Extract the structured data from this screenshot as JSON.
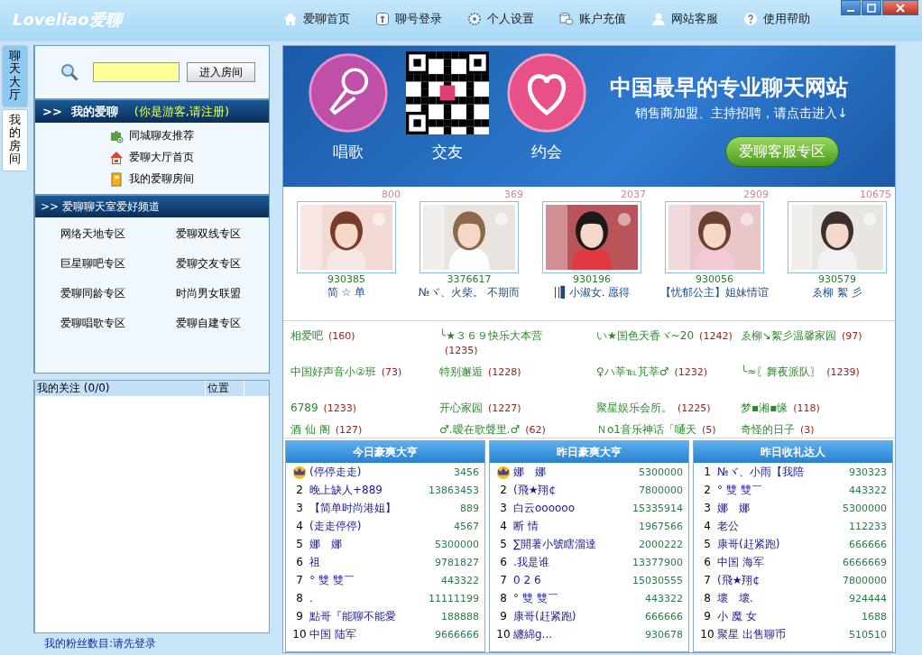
{
  "app": {
    "logo": "Loveliao爱聊"
  },
  "nav": [
    {
      "label": "爱聊首页"
    },
    {
      "label": "聊号登录"
    },
    {
      "label": "个人设置"
    },
    {
      "label": "账户充值"
    },
    {
      "label": "网站客服"
    },
    {
      "label": "使用帮助"
    }
  ],
  "side_tabs": [
    {
      "label": "聊天大厅",
      "selected": true
    },
    {
      "label": "我的房间",
      "selected": false
    }
  ],
  "search": {
    "button": "进入房间"
  },
  "my_section": {
    "title": "我的爱聊",
    "note": "(你是游客,请注册)",
    "arrow": ">>",
    "links": [
      {
        "label": "同城聊友推荐"
      },
      {
        "label": "爱聊大厅首页"
      },
      {
        "label": "我的爱聊房间"
      }
    ]
  },
  "channel_section": {
    "arrow": ">>",
    "title": "爱聊聊天室爱好频道",
    "zones": [
      "网络天地专区",
      "爱聊双线专区",
      "巨星聊吧专区",
      "爱聊交友专区",
      "爱聊同龄专区",
      "时尚男女联盟",
      "爱聊唱歌专区",
      "爱聊自建专区"
    ]
  },
  "follow_list": {
    "columns": [
      "我的关注 (0/0)",
      "位置"
    ]
  },
  "fans": "我的粉丝数目:请先登录",
  "banner": {
    "features": [
      {
        "label": "唱歌"
      },
      {
        "label": "交友"
      },
      {
        "label": "约会"
      }
    ],
    "headline": "中国最早的专业聊天网站",
    "subline": "销售商加盟、主持招聘，请点击进入↓",
    "button": "爱聊客服专区"
  },
  "hosts": [
    {
      "count": "800",
      "id": "930385",
      "name": "简 ☆ 单"
    },
    {
      "count": "369",
      "id": "3376617",
      "name": "№ヾ、火柴。 不期而"
    },
    {
      "count": "2037",
      "id": "930196",
      "name": "||▌小淑女. 愿得"
    },
    {
      "count": "2909",
      "id": "930056",
      "name": "【忧郁公主】姐妹情谊"
    },
    {
      "count": "10675",
      "id": "930579",
      "name": "ゑ柳 絮 彡"
    }
  ],
  "rooms": [
    {
      "name": "相爱吧",
      "count": "(160)"
    },
    {
      "name": "╰★３６９快乐大本营",
      "count": "(1235)"
    },
    {
      "name": "い★国色天香ヾ~20",
      "count": "(1242)"
    },
    {
      "name": "ゑ柳↘絮彡温馨家园",
      "count": "(97)"
    },
    {
      "name": "中国好声音小②班",
      "count": "(73)"
    },
    {
      "name": "特别邂逅",
      "count": "(1228)"
    },
    {
      "name": "♀ハ莘℡芃莘♂",
      "count": "(1232)"
    },
    {
      "name": "╰≈〖舞夜派队〗",
      "count": "(1239)"
    },
    {
      "name": "6789",
      "count": "(1233)"
    },
    {
      "name": "开心家园",
      "count": "(1227)"
    },
    {
      "name": "聚星娱乐会所。",
      "count": "(1225)"
    },
    {
      "name": "梦▪湘▪缘",
      "count": "(118)"
    },
    {
      "name": "酒 仙 阁",
      "count": "(127)"
    },
    {
      "name": "♂.暧在歌聲里.♂",
      "count": "(62)"
    },
    {
      "name": "Ｎo1音乐神话「嗵天",
      "count": "(5)"
    },
    {
      "name": "奇怪的日子",
      "count": "(3)"
    }
  ],
  "rankings": [
    {
      "title": "今日豪爽大亨",
      "rows": [
        {
          "kind": "crown",
          "name": "(停停走走)",
          "value": "3456"
        },
        {
          "kind": "number",
          "rank": "2",
          "name": "晚上缺人+889",
          "value": "13863453"
        },
        {
          "kind": "number",
          "rank": "3",
          "name": "【简单时尚港姐】",
          "value": "889"
        },
        {
          "kind": "number",
          "rank": "4",
          "name": "(走走停停)",
          "value": "4567"
        },
        {
          "kind": "number",
          "rank": "5",
          "name": "娜　娜",
          "value": "5300000"
        },
        {
          "kind": "number",
          "rank": "6",
          "name": "祖",
          "value": "9781827"
        },
        {
          "kind": "number",
          "rank": "7",
          "name": "° 雙 雙￣",
          "value": "443322"
        },
        {
          "kind": "number",
          "rank": "8",
          "name": ".",
          "value": "11111199"
        },
        {
          "kind": "number",
          "rank": "9",
          "name": "點哥『能聊不能愛",
          "value": "188888"
        },
        {
          "kind": "number",
          "rank": "10",
          "name": "中国 陆军",
          "value": "9666666"
        }
      ]
    },
    {
      "title": "昨日豪爽大亨",
      "rows": [
        {
          "kind": "crown",
          "name": "娜　娜",
          "value": "5300000"
        },
        {
          "kind": "number",
          "rank": "2",
          "name": "(飛★翔¢",
          "value": "7800000"
        },
        {
          "kind": "number",
          "rank": "3",
          "name": "白云oooooo",
          "value": "15335914"
        },
        {
          "kind": "number",
          "rank": "4",
          "name": "断 情",
          "value": "1967566"
        },
        {
          "kind": "number",
          "rank": "5",
          "name": "∑開著小號瞎溜達",
          "value": "2000222"
        },
        {
          "kind": "number",
          "rank": "6",
          "name": ".我是谁",
          "value": "13377900"
        },
        {
          "kind": "number",
          "rank": "7",
          "name": "0 2 6",
          "value": "15030555"
        },
        {
          "kind": "number",
          "rank": "8",
          "name": "° 雙 雙￣",
          "value": "443322"
        },
        {
          "kind": "number",
          "rank": "9",
          "name": "康哥(赶紧跑)",
          "value": "666666"
        },
        {
          "kind": "number",
          "rank": "10",
          "name": "纏綿g...",
          "value": "930678"
        }
      ]
    },
    {
      "title": "昨日收礼达人",
      "rows": [
        {
          "kind": "number",
          "rank": "1",
          "name": "№ヾ、小雨【我陪",
          "value": "930323"
        },
        {
          "kind": "number",
          "rank": "2",
          "name": "° 雙 雙￣",
          "value": "443322"
        },
        {
          "kind": "number",
          "rank": "3",
          "name": "娜　娜",
          "value": "5300000"
        },
        {
          "kind": "number",
          "rank": "4",
          "name": "老公",
          "value": "112233"
        },
        {
          "kind": "number",
          "rank": "5",
          "name": "康哥(赶紧跑)",
          "value": "666666"
        },
        {
          "kind": "number",
          "rank": "6",
          "name": "中国 海军",
          "value": "6666669"
        },
        {
          "kind": "number",
          "rank": "7",
          "name": "(飛★翔¢",
          "value": "7800000"
        },
        {
          "kind": "number",
          "rank": "8",
          "name": "壞　壞.",
          "value": "924444"
        },
        {
          "kind": "number",
          "rank": "9",
          "name": "小 魔 女",
          "value": "1688"
        },
        {
          "kind": "number",
          "rank": "10",
          "name": "聚星 出售聊币",
          "value": "510510"
        }
      ]
    }
  ]
}
